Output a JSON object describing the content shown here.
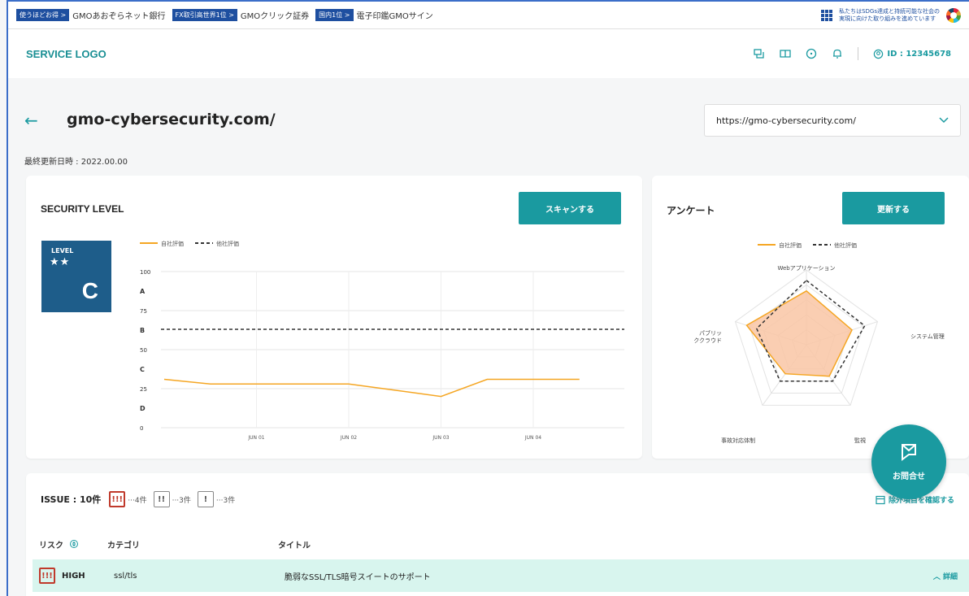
{
  "banner": {
    "items": [
      {
        "tag": "使うほどお得 >",
        "name": "GMOあおぞらネット銀行"
      },
      {
        "tag": "FX取引高世界1位 >",
        "name": "GMOクリック証券"
      },
      {
        "tag": "国内1位 >",
        "name": "電子印鑑GMOサイン"
      }
    ],
    "sdgs_line1": "私たちはSDGs達成と持続可能な社会の",
    "sdgs_line2": "実現に向けた取り組みを進めています"
  },
  "header": {
    "logo": "SERVICE LOGO",
    "user_id": "ID : 12345678",
    "icons": [
      "cart-icon",
      "book-icon",
      "help-icon",
      "bell-icon",
      "user-icon"
    ]
  },
  "page": {
    "title": "gmo-cybersecurity.com/",
    "url_select": "https://gmo-cybersecurity.com/",
    "updated": "最終更新日時 : 2022.00.00"
  },
  "security": {
    "title": "SECURITY LEVEL",
    "scan_button": "スキャンする",
    "level_label": "LEVEL",
    "stars": "★★",
    "grade": "C"
  },
  "survey": {
    "title": "アンケート",
    "update_button": "更新する"
  },
  "chart_data": [
    {
      "type": "line",
      "legend": [
        "自社評価",
        "他社評価"
      ],
      "y_ticks": [
        "100",
        "A",
        "75",
        "B",
        "50",
        "C",
        "25",
        "D",
        "0"
      ],
      "x_ticks": [
        "JUN 01",
        "JUN 02",
        "JUN 03",
        "JUN 04"
      ],
      "ylim": [
        0,
        100
      ],
      "series": [
        {
          "name": "自社評価",
          "color": "#f5a623",
          "style": "solid",
          "x": [
            0,
            0.5,
            1,
            1.5,
            2,
            2.5,
            3,
            3.5,
            4,
            4.5
          ],
          "values": [
            31,
            28,
            28,
            28,
            28,
            24,
            20,
            31,
            31,
            31
          ]
        },
        {
          "name": "他社評価",
          "color": "#333333",
          "style": "dashed",
          "values": [
            63
          ]
        }
      ]
    },
    {
      "type": "radar",
      "legend": [
        "自社評価",
        "他社評価"
      ],
      "axes": [
        "Webアプリケーション",
        "システム管理",
        "監視",
        "事故対応体制",
        "パブリッククラウド"
      ],
      "max": 5,
      "series": [
        {
          "name": "自社評価",
          "color": "#f5a623",
          "values": [
            3.6,
            3.2,
            2.6,
            2.4,
            4.2
          ]
        },
        {
          "name": "他社評価",
          "color": "#333333",
          "values": [
            4.3,
            4.1,
            3.0,
            3.0,
            3.5
          ]
        }
      ]
    }
  ],
  "issue": {
    "label": "ISSUE : 10件",
    "high_count": "···4件",
    "mid_count": "···3件",
    "low_count": "···3件",
    "exclude": "除外項目を確認する",
    "columns": {
      "risk": "リスク",
      "category": "カテゴリ",
      "title": "タイトル"
    },
    "rows": [
      {
        "risk": "HIGH",
        "category": "ssl/tls",
        "title": "脆弱なSSL/TLS暗号スイートのサポート",
        "detail": "詳細"
      }
    ]
  },
  "fab": {
    "label": "お問合せ"
  }
}
